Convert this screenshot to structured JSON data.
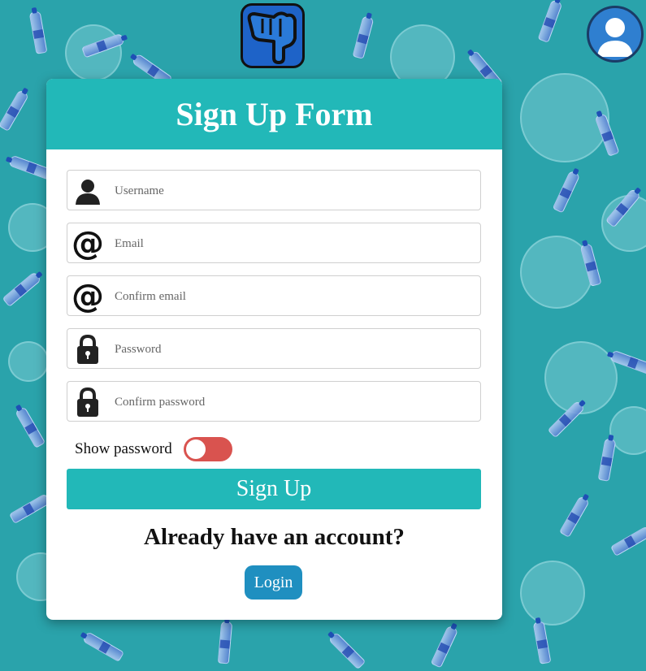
{
  "form": {
    "title": "Sign Up Form",
    "fields": {
      "username": {
        "placeholder": "Username",
        "value": ""
      },
      "email": {
        "placeholder": "Email",
        "value": ""
      },
      "confirm_email": {
        "placeholder": "Confirm email",
        "value": ""
      },
      "password": {
        "placeholder": "Password",
        "value": ""
      },
      "confirm_password": {
        "placeholder": "Confirm password",
        "value": ""
      }
    },
    "show_password_label": "Show password",
    "show_password_on": false,
    "submit_label": "Sign Up",
    "already_text": "Already have an account?",
    "login_label": "Login"
  },
  "colors": {
    "background": "#2aa3ab",
    "header": "#22b8b8",
    "submit": "#22b8b8",
    "toggle_off": "#d9534f",
    "login": "#1f8fc0"
  },
  "icons": {
    "top": "pointing-hand-icon",
    "account": "user-avatar-icon",
    "username": "user-icon",
    "email": "at-sign-icon",
    "password": "lock-icon"
  }
}
